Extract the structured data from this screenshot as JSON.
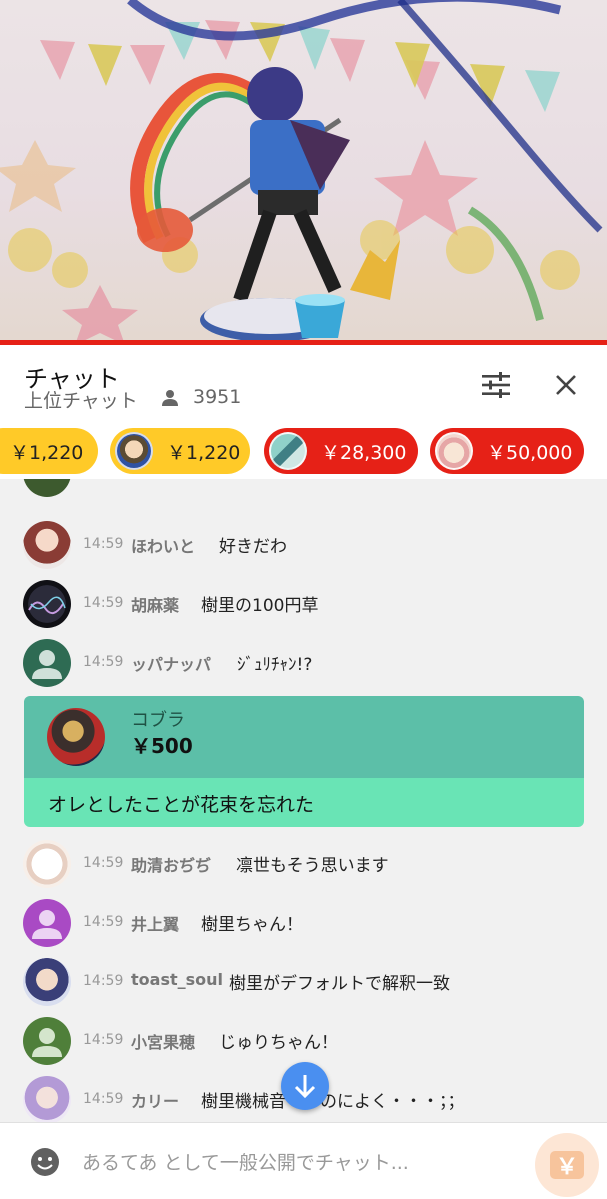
{
  "header": {
    "title": "チャット",
    "mode_label": "上位チャット",
    "viewer_count": "3951"
  },
  "ticker": [
    {
      "amount": "￥1,220",
      "color": "#ffca28"
    },
    {
      "amount": "￥1,220",
      "color": "#ffca28"
    },
    {
      "amount": "￥28,300",
      "color": "#e62117"
    },
    {
      "amount": "￥50,000",
      "color": "#e62117"
    }
  ],
  "messages": [
    {
      "time": "14:59",
      "author": "ほわいと",
      "text": "好きだわ"
    },
    {
      "time": "14:59",
      "author": "胡麻薬",
      "text": "樹里の100円草"
    },
    {
      "time": "14:59",
      "author": "ッパナッパ",
      "text": "ｼﾞｭﾘﾁｬﾝ!?"
    },
    {
      "time": "14:59",
      "author": "助清おぢぢ",
      "text": "凛世もそう思います"
    },
    {
      "time": "14:59",
      "author": "井上翼",
      "text": "樹里ちゃん！"
    },
    {
      "time": "14:59",
      "author": "toast_soul",
      "text": "樹里がデフォルトで解釈一致"
    },
    {
      "time": "14:59",
      "author": "小宮果穂",
      "text": "じゅりちゃん！"
    },
    {
      "time": "14:59",
      "author": "カリー",
      "text": "樹里機械音　　のによく・・・；；"
    }
  ],
  "super_chat": {
    "author": "コブラ",
    "amount": "￥500",
    "message": "オレとしたことが花束を忘れた",
    "header_color": "#5cbfa8",
    "body_color": "#69e4b5"
  },
  "input": {
    "placeholder": "あるてあ として一般公開でチャット..."
  },
  "super_chat_button": {
    "symbol": "￥"
  },
  "colors": {
    "progress": "#e62117",
    "scroll_button": "#4a8ff0"
  }
}
